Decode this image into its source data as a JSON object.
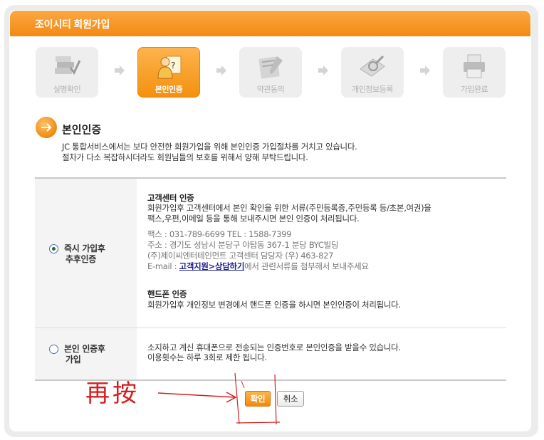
{
  "window": {
    "title": "조이시티 회원가입"
  },
  "steps": [
    {
      "label": "실명확인",
      "icon": "books-check-icon",
      "active": false
    },
    {
      "label": "본인인증",
      "icon": "person-question-icon",
      "active": true
    },
    {
      "label": "약관동의",
      "icon": "clipboard-pen-icon",
      "active": false
    },
    {
      "label": "개인정보등록",
      "icon": "document-search-icon",
      "active": false
    },
    {
      "label": "가입완료",
      "icon": "printer-icon",
      "active": false
    }
  ],
  "section": {
    "title": "본인인증",
    "desc_line1": "JC 통합서비스에서는 보다 안전한 회원가입을 위해 본인인증 가입절차를 거치고 있습니다.",
    "desc_line2": "절차가 다소 복잡하시더라도 회원님들의 보호를 위해서 양해 부탁드립니다."
  },
  "option1": {
    "label_line1": "즉시 가입후",
    "label_line2": "추후인증",
    "selected": true,
    "cs_title": "고객센터 인증",
    "cs_line1": "회원가입후 고객센터에서 본인 확인을 위한 서류(주민등록증,주민등록 등/초본,여권)을",
    "cs_line2": "팩스,우편,이메일 등을 통해 보내주시면 본인 인증이 처리됩니다.",
    "fax": "팩스 : 031-789-6699 TEL : 1588-7399",
    "addr1": "주소 : 경기도 성남시 분당구 야탑동 367-1 분당 BYC빌딩",
    "addr2": "(주)제이씨엔터테인먼트 고객센터 담당자 (우) 463-827",
    "email_prefix": "E-mail : ",
    "email_link": "고객지원>상담하기",
    "email_suffix": "에서 관련서류를 첨부해서 보내주세요",
    "phone_title": "핸드폰 인증",
    "phone_line": "회원가입후 개인정보 변경에서 핸드폰 인증을 하시면 본인인증이 처리됩니다."
  },
  "option2": {
    "label_line1": "본인 인증후",
    "label_line2": "가입",
    "selected": false,
    "line1": "소지하고 계신 휴대폰으로 전송되는 인증번호로 본인인증을 받을수 있습니다.",
    "line2": "이용횟수는 하루 3회로 제한 됩니다."
  },
  "buttons": {
    "confirm": "확인",
    "cancel": "취소"
  },
  "annotation": {
    "text": "再按",
    "color": "#d51e1e"
  },
  "colors": {
    "accent": "#f38a12",
    "link": "#1d1d8f"
  }
}
